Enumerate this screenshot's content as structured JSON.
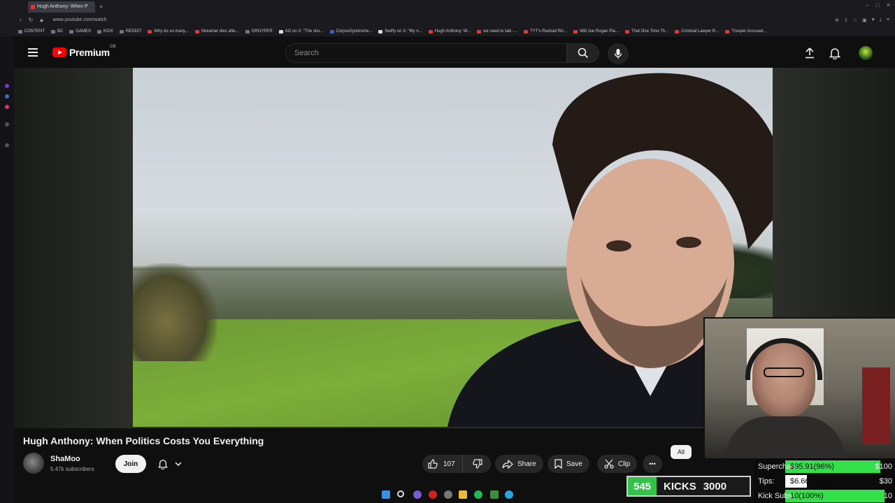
{
  "browser": {
    "tab_title": "Hugh Anthony: When P",
    "url": "www.youtube.com/watch",
    "bookmarks": [
      "CONTENT",
      "BC",
      "GAMES",
      "KICK",
      "REDDIT",
      "Why do so many...",
      "Streamer dies afte...",
      "GROYPER",
      "AG on X: \"The sho...",
      "CorpseSyndrome...",
      "Swifty on X: \"My n...",
      "Hugh Anthony: W...",
      "we need to talk -...",
      "TYT's Rashad Ric...",
      "Will Joe Rogan Pla...",
      "That One Time Th...",
      "Criminal Lawyer R...",
      "Trooper Accused..."
    ]
  },
  "header": {
    "logo_text": "Premium",
    "region": "GB",
    "search_placeholder": "Search"
  },
  "video": {
    "title": "Hugh Anthony: When Politics Costs You Everything",
    "channel": "ShaMoo",
    "subscribers": "5.47k subscribers",
    "join_label": "Join",
    "likes": "107",
    "share_label": "Share",
    "save_label": "Save",
    "clip_label": "Clip",
    "more_label": "•••",
    "chip_all": "All"
  },
  "overlay": {
    "kicks_count": "545",
    "kicks_label": "KICKS",
    "kicks_goal": "3000",
    "goals": [
      {
        "label": "Superchats",
        "value": "$95.91(96%)",
        "target": "$100",
        "fraction": 0.96,
        "color": "#33e04a"
      },
      {
        "label": "Tips:",
        "value": "$6.66(22%)",
        "target": "$30",
        "fraction": 0.22,
        "color": "#ffffff"
      },
      {
        "label": "Kick Subs:",
        "value": "10(100%)",
        "target": "10",
        "fraction": 1.0,
        "color": "#33e04a"
      }
    ]
  },
  "colors": {
    "accent": "#ff0000",
    "kick_green": "#33c24a"
  }
}
